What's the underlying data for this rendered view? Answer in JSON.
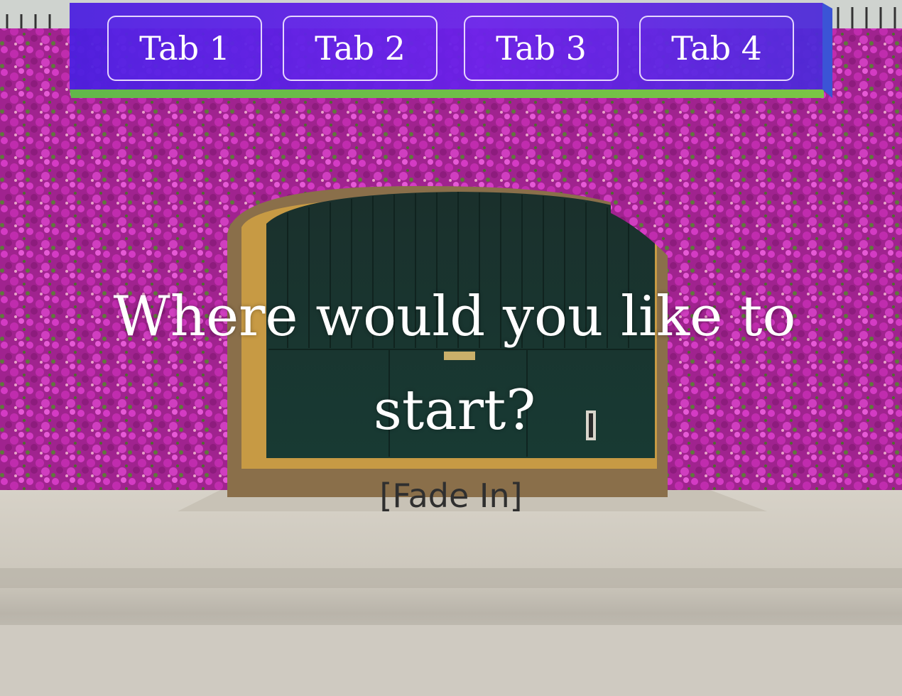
{
  "tabs": [
    {
      "label": "Tab 1"
    },
    {
      "label": "Tab 2"
    },
    {
      "label": "Tab 3"
    },
    {
      "label": "Tab 4"
    }
  ],
  "main": {
    "heading": "Where would you like to start?",
    "subtext": "[Fade In]"
  },
  "colors": {
    "tabbar": "#5a20e6",
    "tabbar_accent": "#6fbf47",
    "tab_border": "#efe6ff",
    "heading": "#ffffff",
    "subtext": "#2f2f2f",
    "door": "#1c3530",
    "flowers": "#b0249c"
  }
}
